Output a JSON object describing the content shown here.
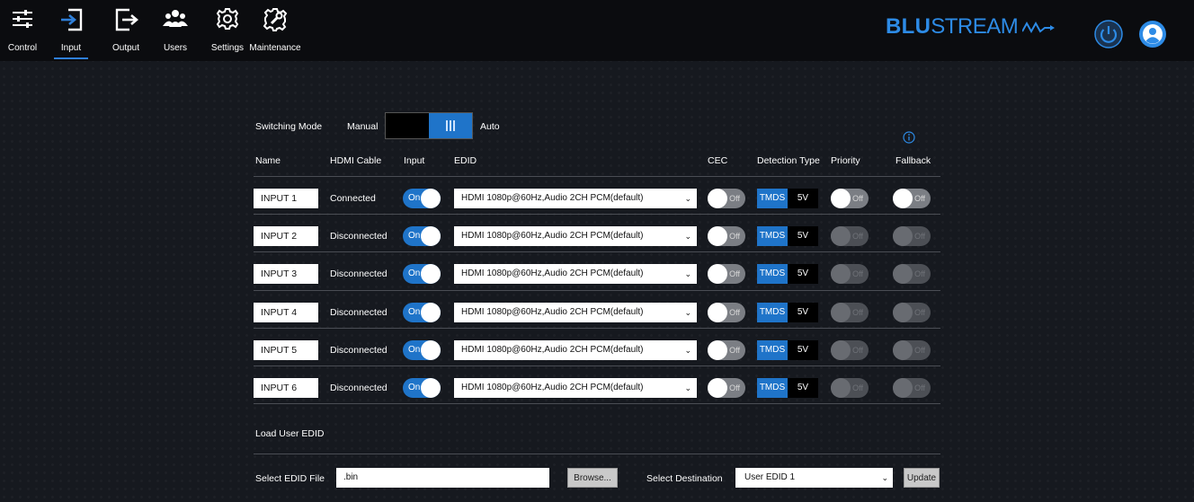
{
  "nav": {
    "items": [
      {
        "label": "Control",
        "icon": "sliders-icon"
      },
      {
        "label": "Input",
        "icon": "input-icon",
        "active": true
      },
      {
        "label": "Output",
        "icon": "output-icon"
      },
      {
        "label": "Users",
        "icon": "users-icon"
      },
      {
        "label": "Settings",
        "icon": "gear-icon"
      },
      {
        "label": "Maintenance",
        "icon": "wrench-gear-icon"
      }
    ]
  },
  "brand": {
    "logo_bold": "BLU",
    "logo_rest": "STREAM",
    "accent": "#2d8be6"
  },
  "switching": {
    "label": "Switching Mode",
    "manual": "Manual",
    "auto": "Auto"
  },
  "headers": {
    "name": "Name",
    "cable": "HDMI Cable",
    "input": "Input",
    "edid": "EDID",
    "cec": "CEC",
    "detection": "Detection Type",
    "priority": "Priority",
    "fallback": "Fallback"
  },
  "toggle_text": {
    "on": "On",
    "off": "Off"
  },
  "detection_labels": {
    "tmds": "TMDS",
    "v5": "5V"
  },
  "rows": [
    {
      "name": "INPUT 1",
      "cable": "Connected",
      "edid": "HDMI 1080p@60Hz,Audio 2CH PCM(default)"
    },
    {
      "name": "INPUT 2",
      "cable": "Disconnected",
      "edid": "HDMI 1080p@60Hz,Audio 2CH PCM(default)"
    },
    {
      "name": "INPUT 3",
      "cable": "Disconnected",
      "edid": "HDMI 1080p@60Hz,Audio 2CH PCM(default)"
    },
    {
      "name": "INPUT 4",
      "cable": "Disconnected",
      "edid": "HDMI 1080p@60Hz,Audio 2CH PCM(default)"
    },
    {
      "name": "INPUT 5",
      "cable": "Disconnected",
      "edid": "HDMI 1080p@60Hz,Audio 2CH PCM(default)"
    },
    {
      "name": "INPUT 6",
      "cable": "Disconnected",
      "edid": "HDMI 1080p@60Hz,Audio 2CH PCM(default)"
    }
  ],
  "load_edid": {
    "title": "Load User EDID",
    "file_label": "Select EDID File",
    "file_value": ".bin",
    "browse": "Browse...",
    "dest_label": "Select Destination",
    "dest_value": "User EDID 1",
    "update": "Update"
  }
}
